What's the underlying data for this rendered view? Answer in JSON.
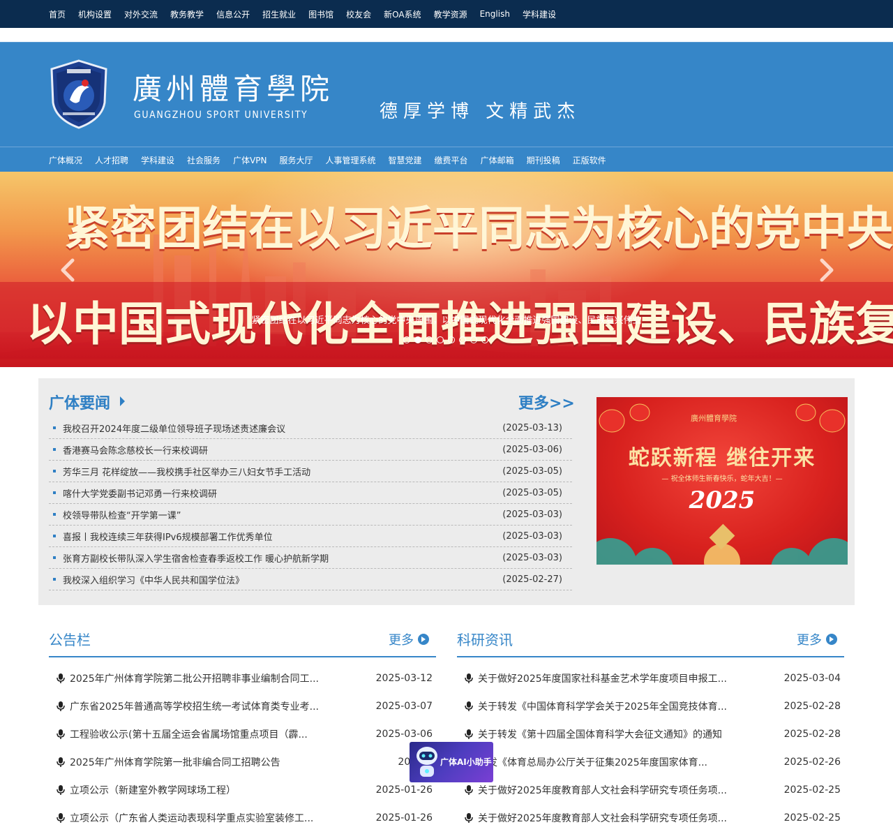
{
  "top_nav": [
    "首页",
    "机构设置",
    "对外交流",
    "教务教学",
    "信息公开",
    "招生就业",
    "图书馆",
    "校友会",
    "新OA系统",
    "教学资源",
    "English",
    "学科建设"
  ],
  "header": {
    "name_cn": "廣州體育學院",
    "name_en": "GUANGZHOU SPORT UNIVERSITY",
    "motto": "德厚学博  文精武杰"
  },
  "sub_nav": [
    "广体概况",
    "人才招聘",
    "学科建设",
    "社会服务",
    "广体VPN",
    "服务大厅",
    "人事管理系统",
    "智慧党建",
    "缴费平台",
    "广体邮箱",
    "期刊投稿",
    "正版软件"
  ],
  "banner": {
    "line1": "紧密团结在以习近平同志为核心的党中央周围",
    "line2": "以中国式现代化全面推进强国建设、民族复兴伟业",
    "caption": "紧密团结在以习近平同志为核心的党中央周围，以中国式现代化全面推进强国建设、民族复兴伟业",
    "slide_count": 8,
    "active_slide": 2
  },
  "news": {
    "title": "广体要闻",
    "more": "更多>>",
    "items": [
      {
        "title": "我校召开2024年度二级单位领导班子现场述责述廉会议",
        "date": "(2025-03-13)"
      },
      {
        "title": "香港赛马会陈念慈校长一行来校调研",
        "date": "(2025-03-06)"
      },
      {
        "title": "芳华三月 花样绽放——我校携手社区举办三八妇女节手工活动",
        "date": "(2025-03-05)"
      },
      {
        "title": "喀什大学党委副书记邓勇一行来校调研",
        "date": "(2025-03-05)"
      },
      {
        "title": "校领导带队检查“开学第一课”",
        "date": "(2025-03-03)"
      },
      {
        "title": "喜报丨我校连续三年获得IPv6规模部署工作优秀单位",
        "date": "(2025-03-03)"
      },
      {
        "title": "张育方副校长带队深入学生宿舍检查春季返校工作 暖心护航新学期",
        "date": "(2025-03-03)"
      },
      {
        "title": "我校深入组织学习《中华人民共和国学位法》",
        "date": "(2025-02-27)"
      }
    ],
    "promo": {
      "logo": "廣州體育學院",
      "headline": "蛇跃新程  继往开来",
      "subline": "— 祝全体师生新春快乐，蛇年大吉！—",
      "year": "2025"
    }
  },
  "notice": {
    "title": "公告栏",
    "more": "更多",
    "items": [
      {
        "title": "2025年广州体育学院第二批公开招聘非事业编制合同工...",
        "date": "2025-03-12"
      },
      {
        "title": "广东省2025年普通高等学校招生统一考试体育类专业考...",
        "date": "2025-03-07"
      },
      {
        "title": "工程验收公示(第十五届全运会省属场馆重点项目（霹...",
        "date": "2025-03-06"
      },
      {
        "title": "2025年广州体育学院第一批非编合同工招聘公告",
        "date": "2025-0"
      },
      {
        "title": "立项公示（新建室外教学网球场工程）",
        "date": "2025-01-26"
      },
      {
        "title": "立项公示（广东省人类运动表现科学重点实验室装修工...",
        "date": "2025-01-26"
      }
    ]
  },
  "research": {
    "title": "科研资讯",
    "more": "更多",
    "items": [
      {
        "title": "关于做好2025年度国家社科基金艺术学年度项目申报工...",
        "date": "2025-03-04"
      },
      {
        "title": "关于转发《中国体育科学学会关于2025年全国竞技体育...",
        "date": "2025-02-28"
      },
      {
        "title": "关于转发《第十四届全国体育科学大会征文通知》的通知",
        "date": "2025-02-28"
      },
      {
        "title": "转发《体育总局办公厅关于征集2025年度国家体育...",
        "date": "2025-02-26"
      },
      {
        "title": "关于做好2025年度教育部人文社会科学研究专项任务项...",
        "date": "2025-02-25"
      },
      {
        "title": "关于做好2025年度教育部人文社会科学研究专项任务项...",
        "date": "2025-02-25"
      }
    ]
  },
  "ai_helper": {
    "label": "广体AI小助手"
  },
  "colors": {
    "top_bar": "#0b2c4f",
    "header": "#3686c8",
    "accent": "#2e7fc4",
    "news_bg": "#ececec"
  },
  "icons": {
    "list_item": "microphone-icon",
    "more": "circle-arrow-right-icon",
    "banner_prev": "chevron-left-icon",
    "banner_next": "chevron-right-icon"
  }
}
